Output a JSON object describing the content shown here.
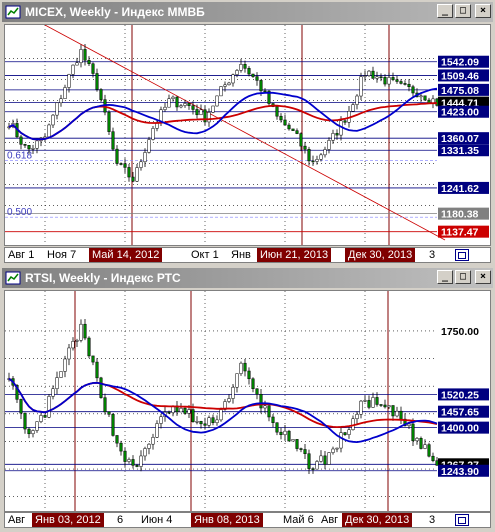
{
  "windows": [
    {
      "title": "MICEX, Weekly - Индекс ММВБ",
      "state": "active",
      "buttons": [
        "_",
        "□",
        "×"
      ],
      "price_labels": [
        {
          "text": "1542.09",
          "value": 1542.09,
          "style": "blue"
        },
        {
          "text": "1509.46",
          "value": 1509.46,
          "style": "blue"
        },
        {
          "text": "1475.08",
          "value": 1475.08,
          "style": "blue"
        },
        {
          "text": "1444.71",
          "value": 1444.71,
          "style": "current"
        },
        {
          "text": "1423.00",
          "value": 1423.0,
          "style": "blue"
        },
        {
          "text": "1360.07",
          "value": 1360.07,
          "style": "blue"
        },
        {
          "text": "1331.35",
          "value": 1331.35,
          "style": "blue"
        },
        {
          "text": "1241.62",
          "value": 1241.62,
          "style": "blue"
        },
        {
          "text": "1180.38",
          "value": 1180.38,
          "style": "gray"
        },
        {
          "text": "1137.47",
          "value": 1137.47,
          "style": "red"
        }
      ],
      "fib_labels": [
        {
          "text": "0.618",
          "value": 1307
        },
        {
          "text": "0.500",
          "value": 1172
        }
      ],
      "axis_labels": [
        {
          "text": "Авг 1",
          "hl": false
        },
        {
          "text": "Ноя 7",
          "hl": false
        },
        {
          "text": "Май 14, 2012",
          "hl": true
        },
        {
          "text": "Окт 1",
          "hl": false
        },
        {
          "text": "Янв",
          "hl": false
        },
        {
          "text": "Июн 21, 2013",
          "hl": true
        },
        {
          "text": "Дек 30, 2013",
          "hl": true
        },
        {
          "text": "3",
          "hl": false
        }
      ],
      "colors": {
        "ma_blue": "#0000cc",
        "ma_red": "#cc0000",
        "candle": "#008000",
        "vline": "#800000",
        "hline": "#000080"
      }
    },
    {
      "title": "RTSI, Weekly - Индекс РТС",
      "state": "inactive",
      "buttons": [
        "_",
        "□",
        "×"
      ],
      "price_labels": [
        {
          "text": "1750.00",
          "value": 1750.0,
          "style": "plain"
        },
        {
          "text": "1520.25",
          "value": 1520.25,
          "style": "blue"
        },
        {
          "text": "1457.65",
          "value": 1457.65,
          "style": "blue"
        },
        {
          "text": "1400.00",
          "value": 1400.0,
          "style": "blue"
        },
        {
          "text": "1267.27",
          "value": 1267.27,
          "style": "current"
        },
        {
          "text": "1243.90",
          "value": 1243.9,
          "style": "blue"
        }
      ],
      "axis_labels": [
        {
          "text": "Авг",
          "hl": false
        },
        {
          "text": "Янв 03, 2012",
          "hl": true
        },
        {
          "text": "6",
          "hl": false
        },
        {
          "text": "Июн 4",
          "hl": false
        },
        {
          "text": "Янв 08, 2013",
          "hl": true
        },
        {
          "text": "Май 6",
          "hl": false
        },
        {
          "text": "Авг",
          "hl": false
        },
        {
          "text": "Дек 30, 2013",
          "hl": true
        },
        {
          "text": "3",
          "hl": false
        }
      ],
      "colors": {
        "ma_blue": "#0000cc",
        "ma_red": "#cc0000",
        "candle": "#008000",
        "vline": "#800000",
        "hline": "#000080"
      }
    }
  ]
}
